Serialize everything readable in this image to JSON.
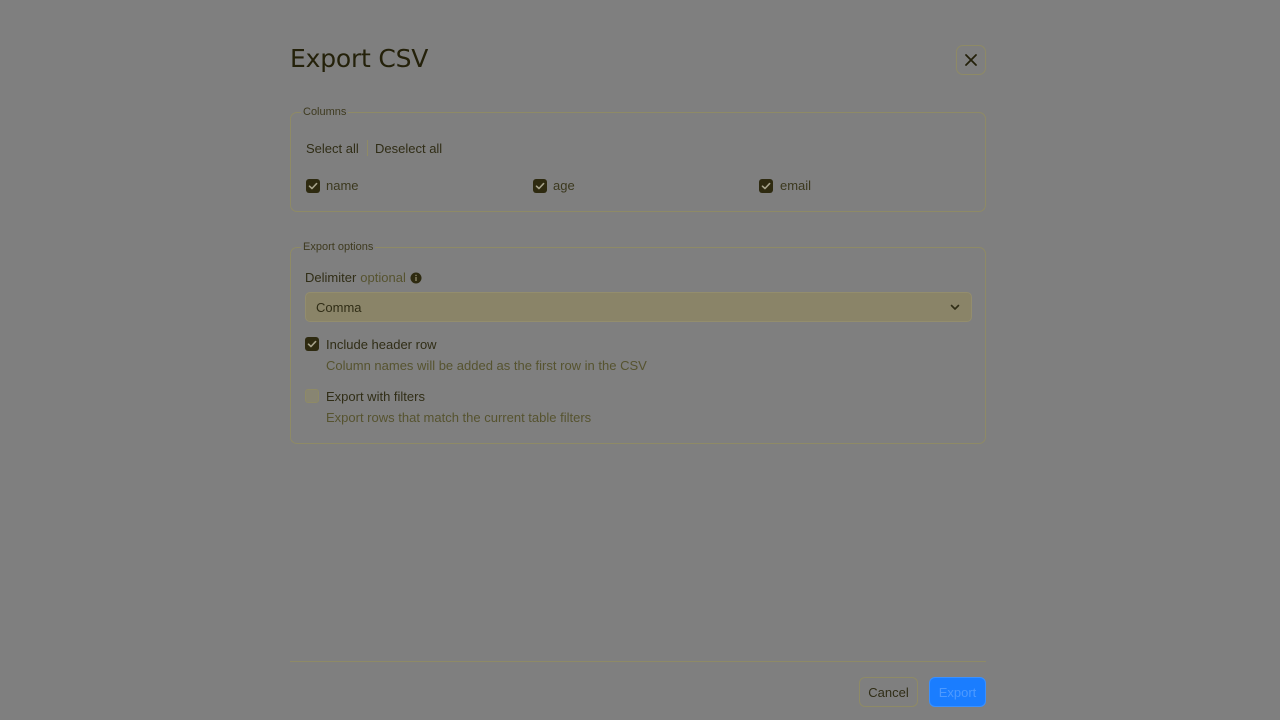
{
  "dialog": {
    "title": "Export CSV"
  },
  "columns": {
    "legend": "Columns",
    "select_all": "Select all",
    "deselect_all": "Deselect all",
    "items": [
      {
        "label": "name",
        "checked": true
      },
      {
        "label": "age",
        "checked": true
      },
      {
        "label": "email",
        "checked": true
      }
    ]
  },
  "options": {
    "legend": "Export options",
    "delimiter_label": "Delimiter",
    "delimiter_optional": "optional",
    "delimiter_value": "Comma",
    "include_header": {
      "title": "Include header row",
      "description": "Column names will be added as the first row in the CSV",
      "checked": true
    },
    "export_filters": {
      "title": "Export with filters",
      "description": "Export rows that match the current table filters",
      "checked": false
    }
  },
  "footer": {
    "cancel": "Cancel",
    "export": "Export"
  },
  "colors": {
    "accent": "#1a7dff",
    "overlay": "#7f7f7f"
  },
  "icons": {
    "close": "close-icon",
    "check": "check-icon",
    "info": "info-icon",
    "chevron": "chevron-down-icon"
  }
}
